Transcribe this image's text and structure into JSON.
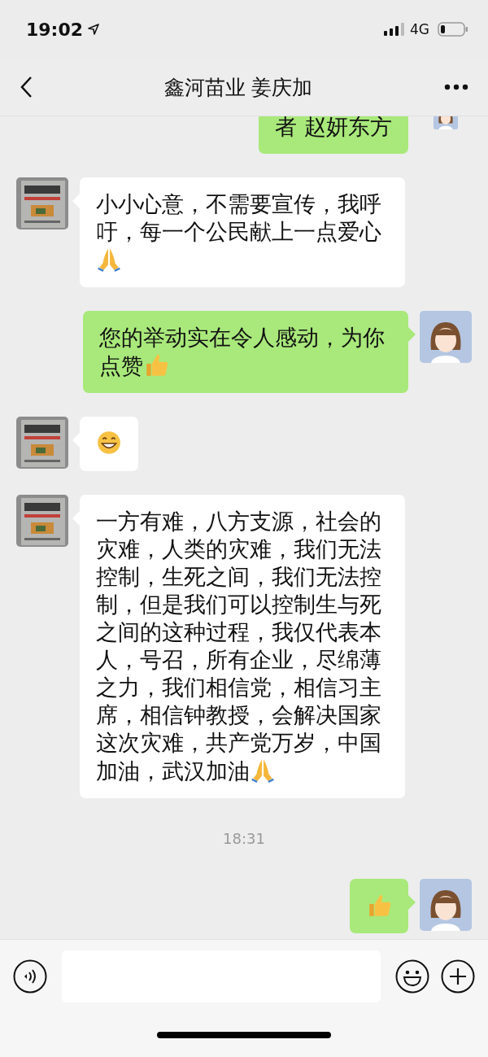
{
  "status_bar": {
    "time": "19:02",
    "network": "4G"
  },
  "header": {
    "title": "鑫河苗业 姜庆加"
  },
  "messages": [
    {
      "kind": "text",
      "outgoing": true,
      "text": "者 赵妍东方",
      "cut": true
    },
    {
      "kind": "text",
      "outgoing": false,
      "text": "小小心意，不需要宣传，我呼吁，每一个公民献上一点爱心",
      "emoji": {
        "kind": "pray"
      },
      "cut": false
    },
    {
      "kind": "text",
      "outgoing": true,
      "text": "您的举动实在令人感动，为你点赞",
      "emoji": {
        "kind": "thumbs"
      },
      "cut": false
    },
    {
      "kind": "emoji",
      "outgoing": false,
      "emoji": {
        "kind": "grin"
      },
      "cut": false
    },
    {
      "kind": "text",
      "outgoing": false,
      "text": "一方有难，八方支源，社会的灾难，人类的灾难，我们无法控制，生死之间，我们无法控制，但是我们可以控制生与死之间的这种过程，我仅代表本人，号召，所有企业，尽绵薄之力，我们相信党，相信习主席，相信钟教授，会解决国家这次灾难，共产党万岁，中国加油，武汉加油",
      "emoji": {
        "kind": "pray"
      },
      "cut": false
    },
    {
      "kind": "time",
      "text": "18:31"
    },
    {
      "kind": "emoji",
      "outgoing": true,
      "emoji": {
        "kind": "thumbs"
      },
      "cut": false
    }
  ]
}
